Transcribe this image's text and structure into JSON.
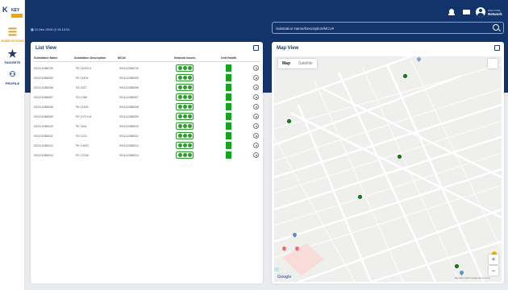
{
  "brand": {
    "short": "K",
    "name": "KEY"
  },
  "sidebar": {
    "items": [
      {
        "label": "SUBSTATIONS",
        "icon": "substation-icon"
      },
      {
        "label": "FAVORITE",
        "icon": "star-icon"
      },
      {
        "label": "PROFILE",
        "icon": "profile-icon"
      }
    ]
  },
  "header": {
    "date": "11 Dec 2019",
    "time": "15:12:01",
    "search_placeholder": "Substation Name/Description/MCU#",
    "welcome": "WELCOME",
    "username": "Network"
  },
  "list_view": {
    "title": "List View",
    "columns": [
      "Substation Name",
      "Substation Description",
      "MCU#",
      "Network Issues",
      "Unit Health"
    ],
    "rows": [
      {
        "name": "001111SB6730",
        "desc": "PK 11003 H",
        "mcu": "001111SB6730"
      },
      {
        "name": "001111SB6305",
        "desc": "PK 11404",
        "mcu": "001111SB6305"
      },
      {
        "name": "001111SB6306",
        "desc": "SS 3327",
        "mcu": "001111SB6306"
      },
      {
        "name": "001111SB6307",
        "desc": "SS 1286",
        "mcu": "001111SB6307"
      },
      {
        "name": "001111SB6308",
        "desc": "PK 11303",
        "mcu": "001111SB6308"
      },
      {
        "name": "001111SB6309",
        "desc": "PK 10714 H",
        "mcu": "001111SB6309"
      },
      {
        "name": "001111SB6310",
        "desc": "PK 3341",
        "mcu": "001111SB6310"
      },
      {
        "name": "001111SB6311",
        "desc": "SS 1123",
        "mcu": "001111SB6311"
      },
      {
        "name": "001111SB6312",
        "desc": "PK 14022",
        "mcu": "001111SB6312"
      },
      {
        "name": "001111SB6314",
        "desc": "PK 12246",
        "mcu": "001111SB6314"
      }
    ]
  },
  "map_view": {
    "title": "Map View",
    "tabs": [
      "Map",
      "Satellite"
    ],
    "google_label": "Google",
    "attribution": "Map data ©2019 Google  Terms of Use",
    "zoom_in": "+",
    "zoom_out": "−"
  },
  "colors": {
    "navy": "#12346b",
    "status_green": "#17a21f",
    "marker_green": "#128a12"
  }
}
